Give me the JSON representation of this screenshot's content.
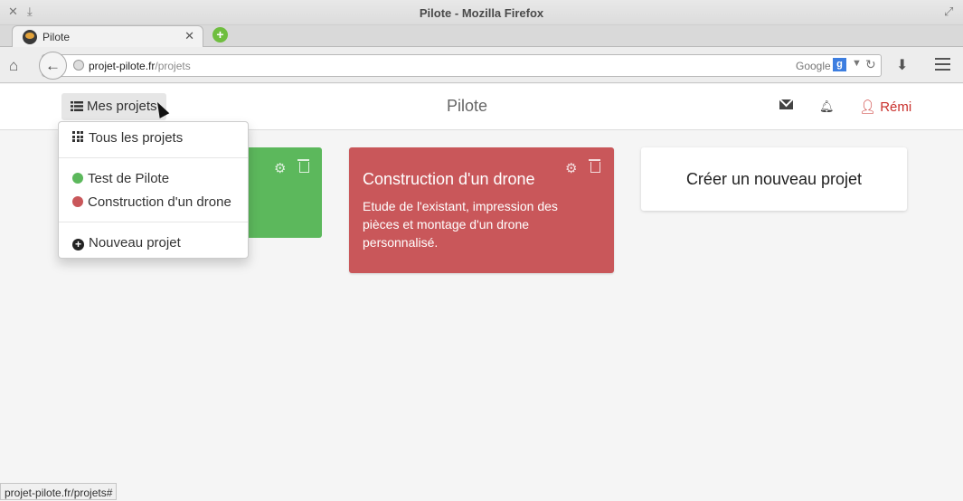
{
  "window": {
    "title": "Pilote - Mozilla Firefox"
  },
  "tab": {
    "label": "Pilote",
    "close": "✕"
  },
  "browser": {
    "url_host": "projet-pilote.fr",
    "url_path": "/projets",
    "search_engine": "Google",
    "status_url": "projet-pilote.fr/projets#"
  },
  "app": {
    "projects_button": "Mes projets",
    "brand": "Pilote",
    "user": "Rémi"
  },
  "dropdown": {
    "all_projects": "Tous les projets",
    "projects": [
      {
        "label": "Test de Pilote",
        "color": "#5cb85c"
      },
      {
        "label": "Construction d'un drone",
        "color": "#c9575a"
      }
    ],
    "new_project": "Nouveau projet"
  },
  "cards": {
    "drone": {
      "title": "Construction d'un drone",
      "description": "Etude de l'existant, impression des pièces et montage d'un drone personnalisé.",
      "color": "#c9575a"
    },
    "test": {
      "color": "#5cb85c"
    },
    "create": {
      "label": "Créer un nouveau projet"
    }
  }
}
